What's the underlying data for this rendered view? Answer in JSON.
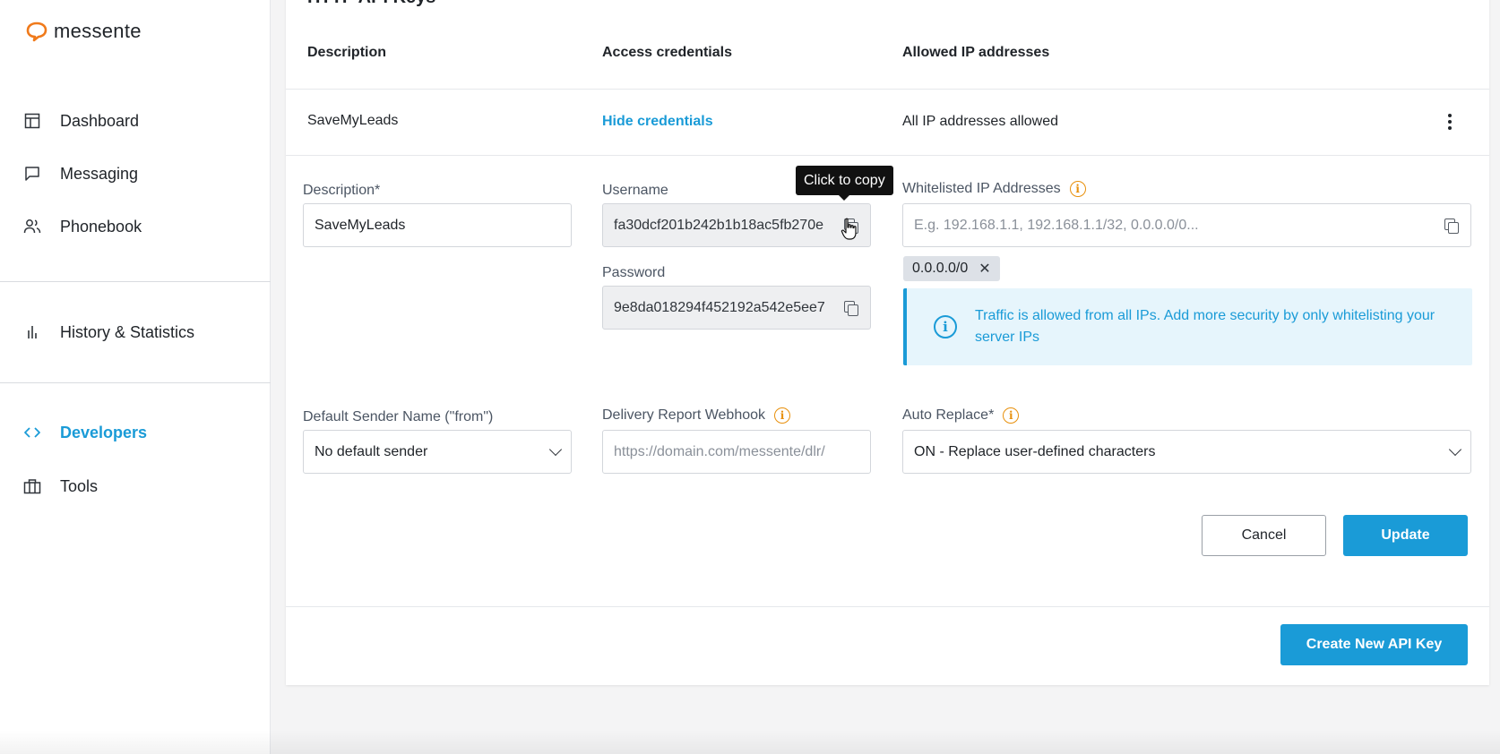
{
  "sidebar": {
    "logo_text": "messente",
    "items": [
      {
        "label": "Dashboard",
        "icon": "layout-icon"
      },
      {
        "label": "Messaging",
        "icon": "chat-icon"
      },
      {
        "label": "Phonebook",
        "icon": "users-icon"
      },
      {
        "label": "History & Statistics",
        "icon": "bar-chart-icon"
      },
      {
        "label": "Developers",
        "icon": "code-icon",
        "active": true
      },
      {
        "label": "Tools",
        "icon": "briefcase-icon"
      }
    ]
  },
  "main": {
    "section_title": "HTTP API Keys",
    "table_headers": {
      "description": "Description",
      "access": "Access credentials",
      "allowed_ips": "Allowed IP addresses"
    },
    "row": {
      "description": "SaveMyLeads",
      "access_link": "Hide credentials",
      "allowed_ips": "All IP addresses allowed"
    },
    "form": {
      "description_label": "Description*",
      "description_value": "SaveMyLeads",
      "username_label": "Username",
      "username_value": "fa30dcf201b242b1b18ac5fb270e",
      "password_label": "Password",
      "password_value": "9e8da018294f452192a542e5ee7",
      "whitelist_label": "Whitelisted IP Addresses",
      "whitelist_placeholder": "E.g. 192.168.1.1, 192.168.1.1/32, 0.0.0.0/0...",
      "ip_chip": "0.0.0.0/0",
      "chip_remove": "✕",
      "notice": "Traffic is allowed from all IPs. Add more security by only whitelisting your server IPs",
      "sender_label": "Default Sender Name (\"from\")",
      "sender_value": "No default sender",
      "webhook_label": "Delivery Report Webhook",
      "webhook_placeholder": "https://domain.com/messente/dlr/",
      "replace_label": "Auto Replace*",
      "replace_value": "ON - Replace user-defined characters",
      "tooltip": "Click to copy"
    },
    "buttons": {
      "cancel": "Cancel",
      "update": "Update",
      "create": "Create New API Key"
    }
  },
  "colors": {
    "accent": "#1a9bd7",
    "warning": "#e8900c",
    "logo": "#f07a1b"
  }
}
